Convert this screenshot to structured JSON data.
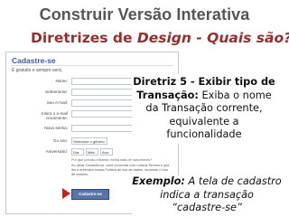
{
  "slide": {
    "title": "Construir Versão Interativa",
    "subtitle_part1": "Diretrizes de ",
    "subtitle_italic": "Design - Quais são?",
    "guideline_head": "Diretriz 5 - Exibir tipo de",
    "guideline_bold": "Transação:",
    "guideline_rest": " Exiba o nome da Transação corrente, equivalente a funcionalidade",
    "example_bold": "Exemplo:",
    "example_rest": " A tela de cadastro indica a transação “cadastre-se”"
  },
  "form": {
    "title": "Cadastre-se",
    "subtitle": "É gratuito e sempre será.",
    "fields": [
      {
        "label": "Nome:"
      },
      {
        "label": "Sobrenome:"
      },
      {
        "label": "Seu e-mail:"
      },
      {
        "label": "Insira o e-mail novamente:"
      },
      {
        "label": "Nova senha:"
      }
    ],
    "sex_label": "Eu sou:",
    "sex_value": "Selecione o gênero:",
    "birthday_label": "Aniversário:",
    "day_value": "Dia:",
    "month_value": "Mês:",
    "year_value": "Ano:",
    "birthday_hint": "Por que preciso informar minha data de nascimento?",
    "terms_text": "Ao clicar Cadastre-se, você concorda com nossos Termos e que leu e entendeu nossa Política de uso de dados, incluindo o Uso de cookies.",
    "submit_label": "Cadastre-se"
  },
  "colors": {
    "title": "#555555",
    "subtitle": "#922f2f",
    "facebook_blue": "#3b5998",
    "arrow": "#d11b1b"
  }
}
